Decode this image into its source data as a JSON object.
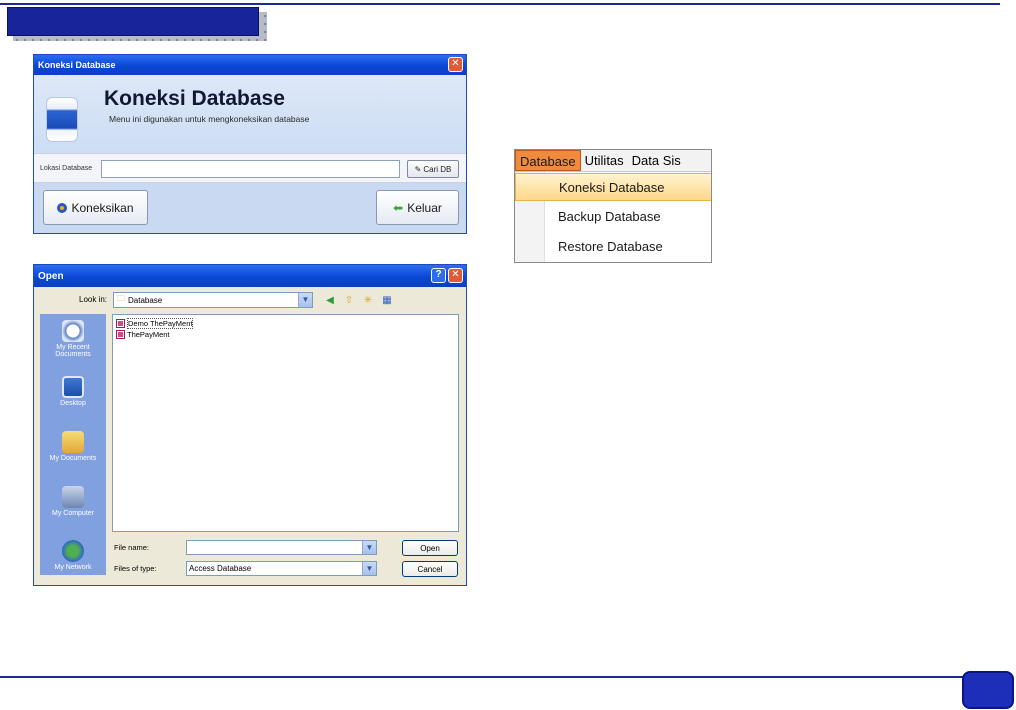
{
  "koneksi_window": {
    "titlebar": "Koneksi Database",
    "heading": "Koneksi Database",
    "subtitle": "Menu ini digunakan untuk mengkoneksikan database",
    "field_label": "Lokasi Database",
    "field_value": "",
    "browse_button": "Cari DB",
    "connect_button": "Koneksikan",
    "exit_button": "Keluar",
    "close_glyph": "✕"
  },
  "open_dialog": {
    "titlebar": "Open",
    "help_glyph": "?",
    "close_glyph": "✕",
    "look_in_label": "Look in:",
    "look_in_value": "Database",
    "places": [
      "My Recent Documents",
      "Desktop",
      "My Documents",
      "My Computer",
      "My Network"
    ],
    "files": [
      "Demo ThePayMent",
      "ThePayMent"
    ],
    "file_name_label": "File name:",
    "file_name_value": "",
    "file_type_label": "Files of type:",
    "file_type_value": "Access Database",
    "open_button": "Open",
    "cancel_button": "Cancel"
  },
  "menu": {
    "bar": [
      "Database",
      "Utilitas",
      "Data Sis"
    ],
    "items": [
      "Koneksi Database",
      "Backup Database",
      "Restore Database"
    ]
  },
  "colors": {
    "slide_accent": "#1b2a8e",
    "menu_active": "#f08a3c",
    "menu_highlight": "#ffd78a"
  }
}
